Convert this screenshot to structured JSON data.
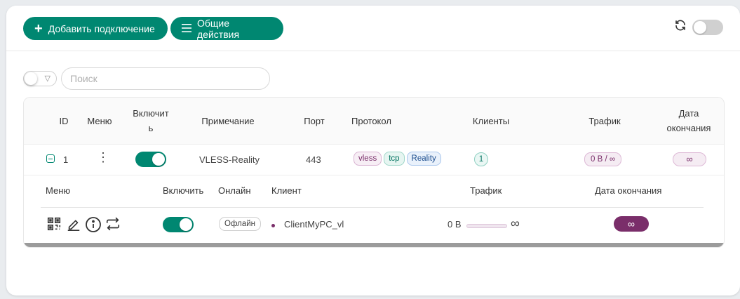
{
  "header": {
    "add_button": "Добавить подключение",
    "add_icon": "plus-icon",
    "general_button": "Общие действия",
    "general_icon": "menu-icon",
    "refresh_icon": "refresh-icon",
    "auto_refresh_enabled": false
  },
  "filter": {
    "toggle_enabled": false,
    "filter_icon": "funnel-icon",
    "search_placeholder": "Поиск",
    "search_value": ""
  },
  "table": {
    "columns": {
      "id": "ID",
      "menu": "Меню",
      "enable": "Включить",
      "remark": "Примечание",
      "port": "Порт",
      "protocol": "Протокол",
      "clients": "Клиенты",
      "traffic": "Трафик",
      "expiry": "Дата окончания"
    },
    "rows": [
      {
        "id": "1",
        "menu_icon": "more-vertical-icon",
        "enabled": true,
        "remark": "VLESS-Reality",
        "port": "443",
        "tags": [
          "vless",
          "tcp",
          "Reality"
        ],
        "clients": "1",
        "traffic": "0 В / ∞",
        "expiry": "∞"
      }
    ]
  },
  "clients_table": {
    "columns": {
      "menu": "Меню",
      "enable": "Включить",
      "online": "Онлайн",
      "client": "Клиент",
      "traffic": "Трафик",
      "expiry": "Дата окончания"
    },
    "rows": [
      {
        "action_icons": [
          "qrcode-icon",
          "edit-icon",
          "info-icon",
          "reset-traffic-icon"
        ],
        "enabled": true,
        "online": "Офлайн",
        "client": "ClientMyPC_vl",
        "traffic_used": "0 В",
        "traffic_total": "∞",
        "expiry": "∞"
      }
    ]
  },
  "colors": {
    "primary": "#008771",
    "accent": "#7a2e6a"
  }
}
